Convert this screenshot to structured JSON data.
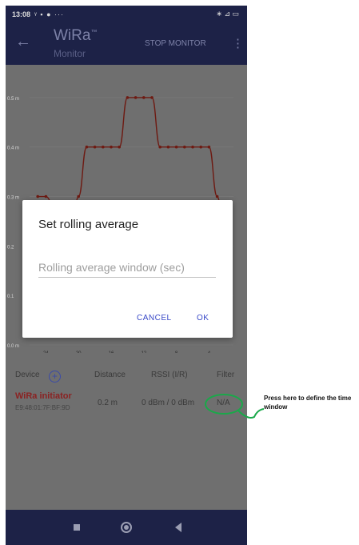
{
  "status_bar": {
    "time": "13:08",
    "left_icons": "ᵞ ▪ ● ···",
    "right_icons": "∗ ⊿ ▭"
  },
  "app_bar": {
    "back_icon": "arrow-left-icon",
    "title": "WiRa",
    "title_mark": "™",
    "subtitle": "Monitor",
    "stop_label": "STOP MONITOR",
    "menu_icon": "more-vert-icon"
  },
  "chart_data": {
    "type": "line",
    "x": [
      25,
      24,
      22,
      21,
      20,
      19,
      18,
      17,
      16,
      15,
      14,
      13,
      12,
      11,
      10,
      9,
      8,
      7,
      6,
      5,
      4,
      3,
      2
    ],
    "y": [
      0.3,
      0.3,
      0.2,
      0.2,
      0.3,
      0.4,
      0.4,
      0.4,
      0.4,
      0.4,
      0.5,
      0.5,
      0.5,
      0.5,
      0.4,
      0.4,
      0.4,
      0.4,
      0.4,
      0.4,
      0.4,
      0.3,
      0.2
    ],
    "y_tick_labels": [
      "0.0 m",
      "0.1",
      "0.2",
      "0.3 m",
      "0.4 m",
      "0.5 m"
    ],
    "x_tick_labels": [
      "24",
      "20",
      "16",
      "12",
      "8",
      "4"
    ],
    "xlim": [
      26,
      1
    ],
    "ylim": [
      0,
      0.55
    ],
    "series_color": "#6e1a12",
    "grid": true
  },
  "table": {
    "headers": {
      "device": "Device",
      "distance": "Distance",
      "rssi": "RSSI (I/R)",
      "filter": "Filter"
    },
    "add_icon": "plus-circle-icon",
    "rows": [
      {
        "name": "WiRa initiator",
        "mac": "E9:48:01:7F:BF:9D",
        "distance": "0.2 m",
        "rssi": "0 dBm / 0 dBm",
        "filter": "N/A"
      }
    ]
  },
  "dialog": {
    "title": "Set rolling average",
    "placeholder": "Rolling average window (sec)",
    "cancel": "CANCEL",
    "ok": "OK"
  },
  "annotation": {
    "text": "Press here to define the time window",
    "color": "#1aa84a"
  },
  "nav": {
    "recents_icon": "square-icon",
    "home_icon": "circle-icon",
    "back_icon": "triangle-back-icon"
  }
}
